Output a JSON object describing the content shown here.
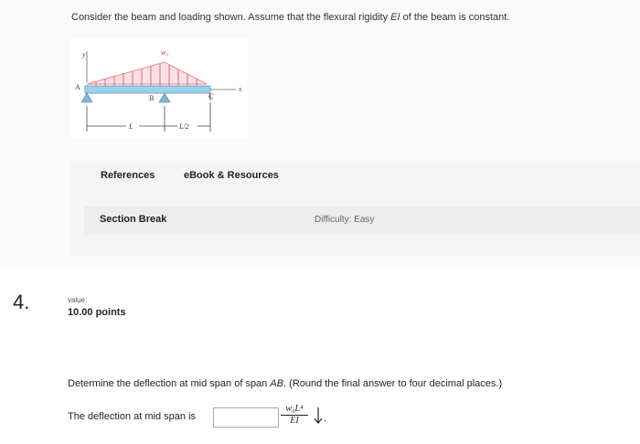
{
  "prev_question": {
    "prompt_before": "Consider the beam and loading shown. Assume that the flexural rigidity ",
    "prompt_ei": "EI",
    "prompt_after": " of the beam is constant.",
    "figure": {
      "y_label": "y",
      "x_label": "x",
      "load_label": "w₀",
      "point_a": "A",
      "point_b": "B",
      "point_c": "C",
      "dim_l": "L",
      "dim_l2": "L/2"
    },
    "tabs": [
      "References",
      "eBook & Resources"
    ],
    "section_break": "Section Break",
    "difficulty": "Difficulty: Easy"
  },
  "question": {
    "number": "4.",
    "value_label": "value:",
    "value_points": "10.00 points",
    "text_before": "Determine the deflection at mid span of span ",
    "text_ab": "AB",
    "text_after": ". (Round the final answer to four decimal places.)",
    "answer_label": "The deflection at mid span is",
    "answer_value": "",
    "unit_numerator": "w₀L⁴",
    "unit_denominator": "EI",
    "trailing": ".",
    "arrow_direction": "down-arrow-icon"
  },
  "colors": {
    "beam": "#9ed0ea",
    "load": "#f08a9a",
    "support": "#7fb6d6"
  }
}
